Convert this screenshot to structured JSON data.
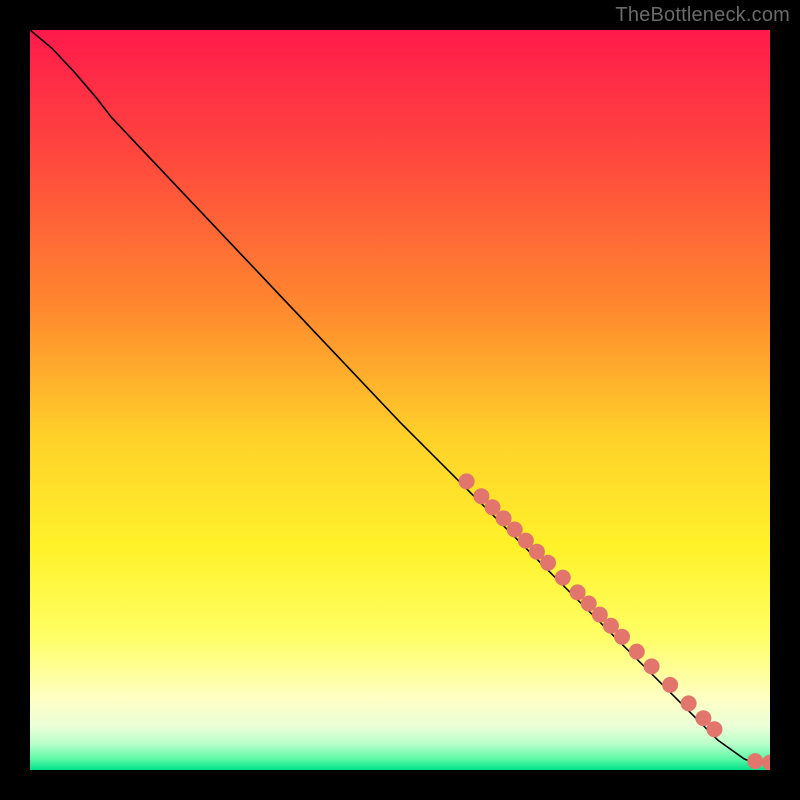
{
  "attribution": "TheBottleneck.com",
  "chart_data": {
    "type": "line",
    "title": "",
    "xlabel": "",
    "ylabel": "",
    "xlim": [
      0,
      100
    ],
    "ylim": [
      0,
      100
    ],
    "grid": false,
    "legend": false,
    "gradient_stops": [
      {
        "offset": 0.0,
        "color": "#ff1a4b"
      },
      {
        "offset": 0.18,
        "color": "#ff4a3d"
      },
      {
        "offset": 0.38,
        "color": "#ff8a2e"
      },
      {
        "offset": 0.55,
        "color": "#ffd12a"
      },
      {
        "offset": 0.7,
        "color": "#fff22a"
      },
      {
        "offset": 0.82,
        "color": "#ffff66"
      },
      {
        "offset": 0.9,
        "color": "#ffffc0"
      },
      {
        "offset": 0.94,
        "color": "#ecffd8"
      },
      {
        "offset": 0.965,
        "color": "#b8ffca"
      },
      {
        "offset": 0.985,
        "color": "#5cf8a6"
      },
      {
        "offset": 1.0,
        "color": "#00e38a"
      }
    ],
    "series": [
      {
        "name": "curve",
        "type": "line",
        "color": "#000000",
        "width": 1.6,
        "points": [
          {
            "x": 0.0,
            "y": 100.0
          },
          {
            "x": 3.0,
            "y": 97.5
          },
          {
            "x": 6.0,
            "y": 94.3
          },
          {
            "x": 9.0,
            "y": 90.8
          },
          {
            "x": 11.0,
            "y": 88.2
          },
          {
            "x": 50.0,
            "y": 47.0
          },
          {
            "x": 85.0,
            "y": 12.0
          },
          {
            "x": 93.0,
            "y": 4.0
          },
          {
            "x": 96.5,
            "y": 1.5
          },
          {
            "x": 98.0,
            "y": 0.9
          },
          {
            "x": 99.5,
            "y": 0.8
          },
          {
            "x": 100.0,
            "y": 0.8
          }
        ]
      },
      {
        "name": "markers",
        "type": "scatter",
        "color": "#e2766c",
        "radius": 8,
        "points": [
          {
            "x": 59.0,
            "y": 39.0
          },
          {
            "x": 61.0,
            "y": 37.0
          },
          {
            "x": 62.5,
            "y": 35.5
          },
          {
            "x": 64.0,
            "y": 34.0
          },
          {
            "x": 65.5,
            "y": 32.5
          },
          {
            "x": 67.0,
            "y": 31.0
          },
          {
            "x": 68.5,
            "y": 29.5
          },
          {
            "x": 70.0,
            "y": 28.0
          },
          {
            "x": 72.0,
            "y": 26.0
          },
          {
            "x": 74.0,
            "y": 24.0
          },
          {
            "x": 75.5,
            "y": 22.5
          },
          {
            "x": 77.0,
            "y": 21.0
          },
          {
            "x": 78.5,
            "y": 19.5
          },
          {
            "x": 80.0,
            "y": 18.0
          },
          {
            "x": 82.0,
            "y": 16.0
          },
          {
            "x": 84.0,
            "y": 14.0
          },
          {
            "x": 86.5,
            "y": 11.5
          },
          {
            "x": 89.0,
            "y": 9.0
          },
          {
            "x": 91.0,
            "y": 7.0
          },
          {
            "x": 92.5,
            "y": 5.5
          },
          {
            "x": 98.0,
            "y": 1.2
          },
          {
            "x": 100.0,
            "y": 1.0
          }
        ]
      }
    ]
  }
}
